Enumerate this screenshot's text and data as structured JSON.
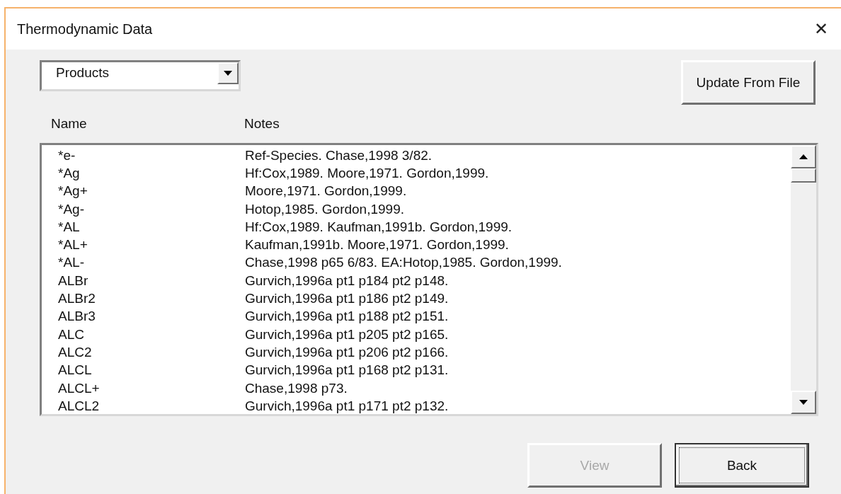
{
  "window": {
    "title": "Thermodynamic Data",
    "close_glyph": "✕"
  },
  "dropdown": {
    "value": "Products"
  },
  "update_button": {
    "label": "Update From File"
  },
  "list": {
    "columns": [
      "Name",
      "Notes"
    ],
    "rows": [
      {
        "name": "*e-",
        "notes": "Ref-Species. Chase,1998 3/82."
      },
      {
        "name": "*Ag",
        "notes": "Hf:Cox,1989. Moore,1971. Gordon,1999."
      },
      {
        "name": "*Ag+",
        "notes": "Moore,1971. Gordon,1999."
      },
      {
        "name": "*Ag-",
        "notes": "Hotop,1985. Gordon,1999."
      },
      {
        "name": "*AL",
        "notes": "Hf:Cox,1989. Kaufman,1991b. Gordon,1999."
      },
      {
        "name": "*AL+",
        "notes": "Kaufman,1991b. Moore,1971. Gordon,1999."
      },
      {
        "name": "*AL-",
        "notes": "Chase,1998 p65 6/83. EA:Hotop,1985. Gordon,1999."
      },
      {
        "name": "ALBr",
        "notes": "Gurvich,1996a pt1 p184 pt2 p148."
      },
      {
        "name": "ALBr2",
        "notes": "Gurvich,1996a pt1 p186 pt2 p149."
      },
      {
        "name": "ALBr3",
        "notes": "Gurvich,1996a pt1 p188 pt2 p151."
      },
      {
        "name": "ALC",
        "notes": "Gurvich,1996a pt1 p205 pt2 p165."
      },
      {
        "name": "ALC2",
        "notes": "Gurvich,1996a pt1 p206 pt2 p166."
      },
      {
        "name": "ALCL",
        "notes": "Gurvich,1996a pt1 p168 pt2 p131."
      },
      {
        "name": "ALCL+",
        "notes": "Chase,1998 p73."
      },
      {
        "name": "ALCL2",
        "notes": "Gurvich,1996a pt1 p171 pt2 p132."
      }
    ]
  },
  "buttons": [
    {
      "label": "View",
      "disabled": true,
      "focused": false
    },
    {
      "label": "Back",
      "disabled": false,
      "focused": true
    }
  ]
}
